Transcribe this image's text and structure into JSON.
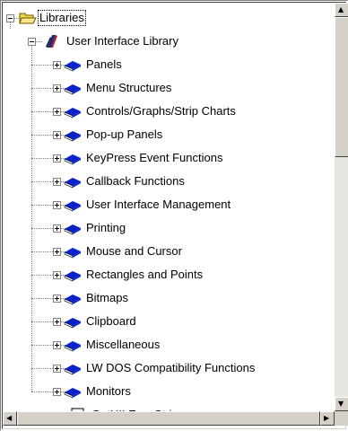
{
  "tree": {
    "root": {
      "label": "Libraries",
      "icon": "open-folder-icon",
      "expanded": true
    },
    "library": {
      "label": "User Interface Library",
      "icon": "library-book-icon",
      "expanded": true
    },
    "items": [
      {
        "label": "Panels",
        "icon": "book-icon",
        "expander": "+"
      },
      {
        "label": "Menu Structures",
        "icon": "book-icon",
        "expander": "+"
      },
      {
        "label": "Controls/Graphs/Strip Charts",
        "icon": "book-icon",
        "expander": "+"
      },
      {
        "label": "Pop-up Panels",
        "icon": "book-icon",
        "expander": "+"
      },
      {
        "label": "KeyPress Event Functions",
        "icon": "book-icon",
        "expander": "+"
      },
      {
        "label": "Callback Functions",
        "icon": "book-icon",
        "expander": "+"
      },
      {
        "label": "User Interface Management",
        "icon": "book-icon",
        "expander": "+"
      },
      {
        "label": "Printing",
        "icon": "book-icon",
        "expander": "+"
      },
      {
        "label": "Mouse and Cursor",
        "icon": "book-icon",
        "expander": "+"
      },
      {
        "label": "Rectangles and Points",
        "icon": "book-icon",
        "expander": "+"
      },
      {
        "label": "Bitmaps",
        "icon": "book-icon",
        "expander": "+"
      },
      {
        "label": "Clipboard",
        "icon": "book-icon",
        "expander": "+"
      },
      {
        "label": "Miscellaneous",
        "icon": "book-icon",
        "expander": "+"
      },
      {
        "label": "LW DOS Compatibility Functions",
        "icon": "book-icon",
        "expander": "+"
      },
      {
        "label": "Monitors",
        "icon": "book-icon",
        "expander": "+"
      }
    ],
    "leaf": {
      "label": "GetUILErrorString",
      "icon": "function-panel-icon"
    }
  },
  "scrollbars": {
    "up_arrow": "▲",
    "down_arrow": "▼",
    "left_arrow": "◀",
    "right_arrow": "▶"
  },
  "colors": {
    "book": "#0a22c8",
    "book_pages": "#ffffff",
    "folder": "#f2d24a",
    "library_red": "#c81818",
    "library_blue": "#1a2a8c"
  }
}
